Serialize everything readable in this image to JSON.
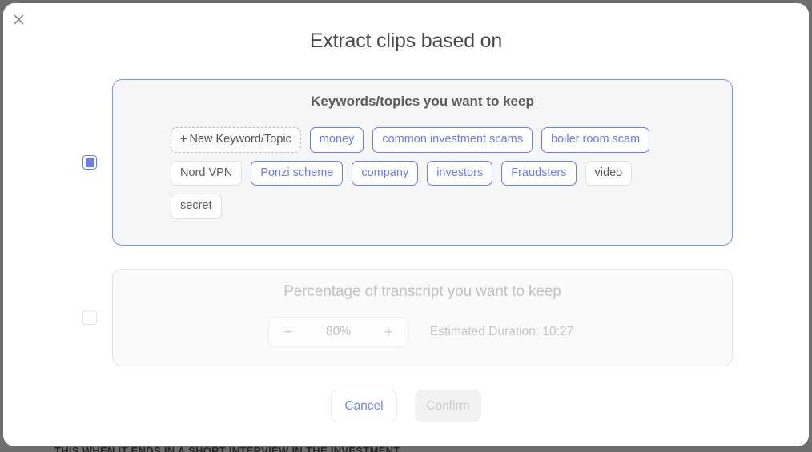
{
  "background": {
    "cut_off_text": "THIS WHEN IT ENDS IN A SHORT INTERVIEW IN THE INVESTMENT"
  },
  "dialog": {
    "title": "Extract clips based on",
    "close_icon": "close-icon"
  },
  "keywords_option": {
    "checked": true,
    "panel_title": "Keywords/topics you want to keep",
    "new_tag": {
      "plus": "+",
      "label": "New Keyword/Topic"
    },
    "tags": [
      {
        "label": "money",
        "selected": true
      },
      {
        "label": "common investment scams",
        "selected": true
      },
      {
        "label": "boiler room scam",
        "selected": true
      },
      {
        "label": "Nord VPN",
        "selected": false
      },
      {
        "label": "Ponzi scheme",
        "selected": true
      },
      {
        "label": "company",
        "selected": true
      },
      {
        "label": "investors",
        "selected": true
      },
      {
        "label": "Fraudsters",
        "selected": true
      },
      {
        "label": "video",
        "selected": false
      },
      {
        "label": "secret",
        "selected": false
      }
    ]
  },
  "percent_option": {
    "checked": false,
    "panel_title": "Percentage of transcript you want to keep",
    "stepper": {
      "decrement": "−",
      "value": "80%",
      "increment": "+"
    },
    "estimated_duration": "Estimated Duration: 10:27"
  },
  "footer": {
    "cancel_label": "Cancel",
    "confirm_label": "Confirm"
  },
  "colors": {
    "accent_blue": "#6b7cf0",
    "panel_border_active": "#7b94ea",
    "panel_bg": "#f6f6f6",
    "page_bg": "#6e6e6e",
    "disabled_text": "#c2c2c2"
  }
}
